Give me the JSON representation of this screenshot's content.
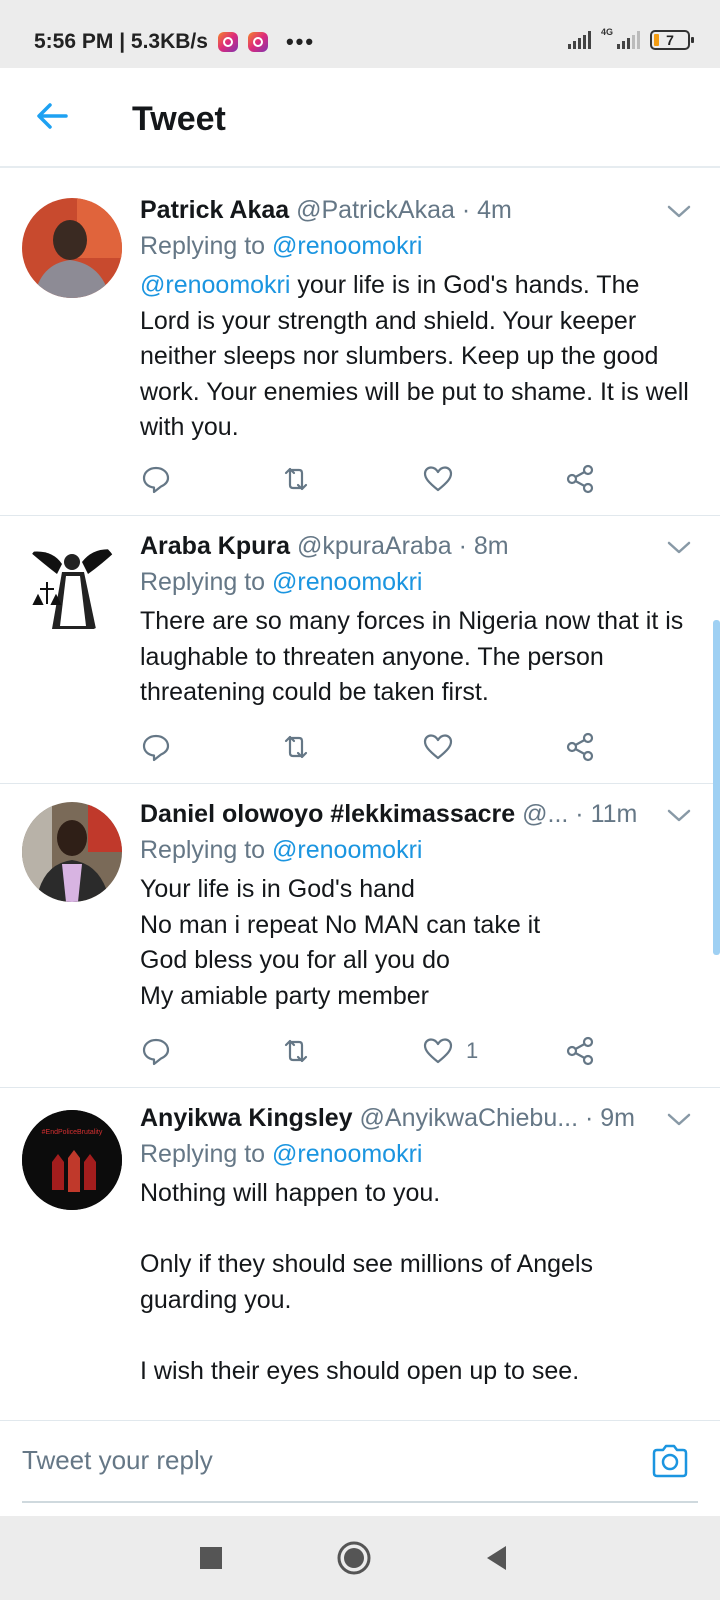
{
  "status_bar": {
    "time_speed": "5:56 PM | 5.3KB/s",
    "more": "•••",
    "network": "4G",
    "battery": "7"
  },
  "header": {
    "title": "Tweet"
  },
  "tweets": [
    {
      "name": "Patrick Akaa",
      "handle": "@PatrickAkaa",
      "time": " · 4m",
      "replying_label": "Replying to ",
      "replying_to": "@renoomokri",
      "mention": "@renoomokri",
      "text": " your life is in God's hands. The Lord is your strength and shield. Your keeper neither sleeps nor slumbers. Keep up the good work. Your enemies will be put to shame. It is well with you.",
      "like_count": ""
    },
    {
      "name": "Araba Kpura",
      "handle": "@kpuraAraba",
      "time": " · 8m",
      "replying_label": "Replying to ",
      "replying_to": "@renoomokri",
      "text": "There are so many forces in Nigeria now that it is laughable to threaten anyone. The person threatening could be taken first.",
      "like_count": ""
    },
    {
      "name": "Daniel olowoyo #lekkimassacre",
      "handle": "@...",
      "time": " · 11m",
      "replying_label": "Replying to ",
      "replying_to": "@renoomokri",
      "text": "Your life is in God's hand\nNo man i repeat No MAN can take it\nGod bless you for all you do\nMy amiable party member",
      "like_count": "1"
    },
    {
      "name": "Anyikwa Kingsley",
      "handle": "@AnyikwaChiebu...",
      "time": " · 9m",
      "replying_label": "Replying to ",
      "replying_to": "@renoomokri",
      "text": "Nothing will happen to you.\n\nOnly if they should see millions of Angels guarding you.\n\nI wish their eyes should open up to see.",
      "avatar_text": "#EndPoliceBrutality"
    }
  ],
  "composer": {
    "placeholder": "Tweet your reply"
  },
  "colors": {
    "accent": "#1b95e0",
    "secondary_text": "#657786",
    "primary_text": "#14171a"
  }
}
